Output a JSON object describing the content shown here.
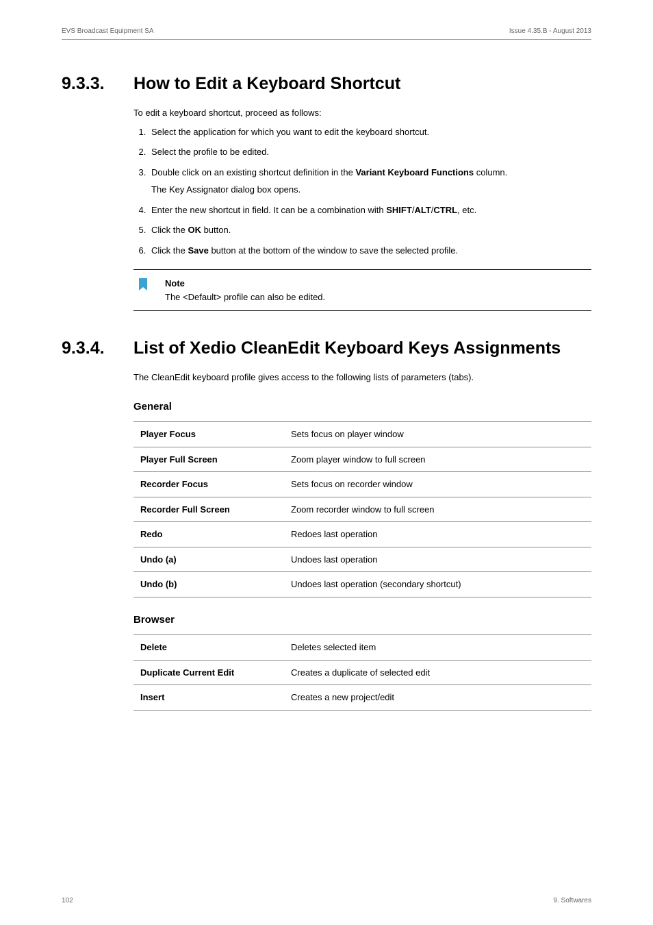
{
  "header": {
    "left": "EVS Broadcast Equipment SA",
    "right": "Issue 4.35.B - August 2013"
  },
  "section1": {
    "number": "9.3.3.",
    "title": "How to Edit a Keyboard Shortcut",
    "intro": "To edit a keyboard shortcut, proceed as follows:",
    "steps": {
      "s1": "Select the application for which you want to edit the keyboard shortcut.",
      "s2": "Select the profile to be edited.",
      "s3a": "Double click on an existing shortcut definition in the ",
      "s3b": "Variant Keyboard Functions",
      "s3c": " column.",
      "s3sub": "The Key Assignator dialog box opens.",
      "s4a": "Enter the new shortcut in field. It can be a combination with ",
      "s4b": "SHIFT",
      "s4c": "/",
      "s4d": "ALT",
      "s4e": "/",
      "s4f": "CTRL",
      "s4g": ", etc.",
      "s5a": "Click the ",
      "s5b": "OK",
      "s5c": " button.",
      "s6a": "Click the ",
      "s6b": "Save",
      "s6c": " button at the bottom of the window to save the selected profile."
    },
    "note": {
      "title": "Note",
      "body": "The <Default> profile can also be edited."
    }
  },
  "section2": {
    "number": "9.3.4.",
    "title": "List of Xedio CleanEdit Keyboard Keys Assignments",
    "intro": "The CleanEdit keyboard profile gives access to the following lists of parameters (tabs).",
    "general_heading": "General",
    "general_rows": [
      {
        "k": "Player Focus",
        "v": "Sets focus on player window"
      },
      {
        "k": "Player Full Screen",
        "v": "Zoom player window to full screen"
      },
      {
        "k": "Recorder Focus",
        "v": "Sets focus on recorder window"
      },
      {
        "k": "Recorder Full Screen",
        "v": "Zoom recorder window to full screen"
      },
      {
        "k": "Redo",
        "v": "Redoes last operation"
      },
      {
        "k": "Undo (a)",
        "v": "Undoes last operation"
      },
      {
        "k": "Undo (b)",
        "v": "Undoes last operation (secondary shortcut)"
      }
    ],
    "browser_heading": "Browser",
    "browser_rows": [
      {
        "k": "Delete",
        "v": "Deletes selected item"
      },
      {
        "k": "Duplicate Current Edit",
        "v": "Creates a duplicate of selected edit"
      },
      {
        "k": "Insert",
        "v": "Creates a new project/edit"
      }
    ]
  },
  "footer": {
    "left": "102",
    "right": "9. Softwares"
  }
}
